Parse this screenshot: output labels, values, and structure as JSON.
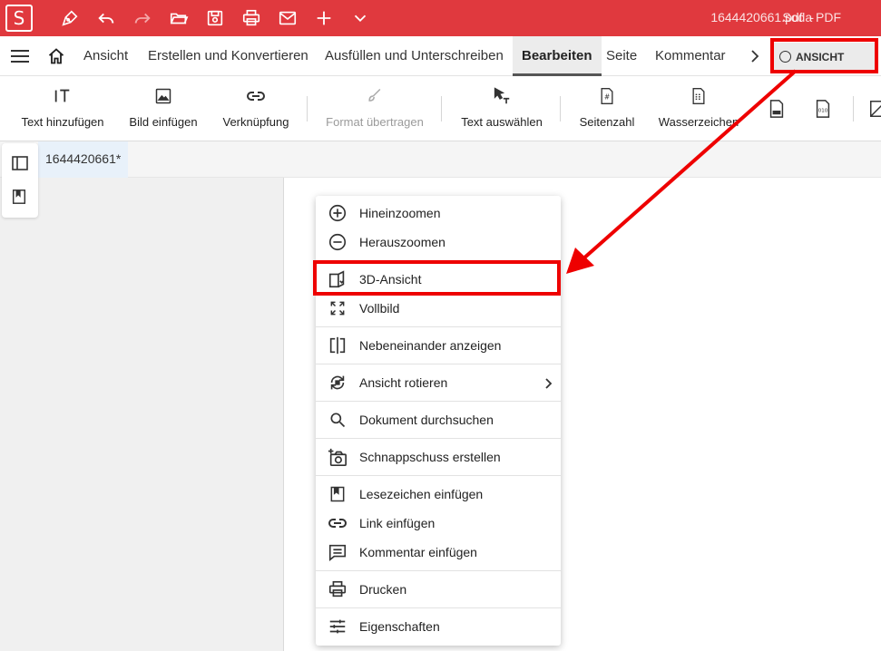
{
  "titlebar": {
    "logo_letter": "S",
    "file_name": "1644420661.pdf",
    "separator": "-",
    "app_name": "Soda PDF",
    "background_color": "#e0393e"
  },
  "quick_access": [
    "pen-icon",
    "undo-icon",
    "redo-icon",
    "open-folder-icon",
    "save-icon",
    "print-icon",
    "mail-icon",
    "plus-icon",
    "chevron-down-icon"
  ],
  "tabs": {
    "items": [
      {
        "label": "Ansicht"
      },
      {
        "label": "Erstellen und Konvertieren"
      },
      {
        "label": "Ausfüllen und Unterschreiben"
      },
      {
        "label": "Bearbeiten"
      },
      {
        "label": "Seite"
      },
      {
        "label": "Kommentar"
      }
    ],
    "active": "Bearbeiten",
    "view_button_label": "ANSICHT"
  },
  "toolbar": {
    "items": [
      {
        "label": "Text hinzufügen",
        "icon": "text-add-icon",
        "enabled": true
      },
      {
        "label": "Bild einfügen",
        "icon": "image-icon",
        "enabled": true
      },
      {
        "label": "Verknüpfung",
        "icon": "link-icon",
        "enabled": true
      },
      {
        "label": "Format übertragen",
        "icon": "format-brush-icon",
        "enabled": false
      },
      {
        "label": "Text auswählen",
        "icon": "text-select-icon",
        "enabled": true
      },
      {
        "label": "Seitenzahl",
        "icon": "page-number-icon",
        "enabled": true
      },
      {
        "label": "Wasserzeichen",
        "icon": "watermark-icon",
        "enabled": true
      }
    ]
  },
  "document_tab": {
    "label": "1644420661*"
  },
  "context_menu": {
    "items": [
      {
        "label": "Hineinzoomen",
        "icon": "zoom-in-icon"
      },
      {
        "label": "Herauszoomen",
        "icon": "zoom-out-icon"
      },
      {
        "label": "3D-Ansicht",
        "icon": "3d-view-icon",
        "highlighted": true
      },
      {
        "label": "Vollbild",
        "icon": "fullscreen-icon"
      },
      {
        "label": "Nebeneinander anzeigen",
        "icon": "side-by-side-icon"
      },
      {
        "label": "Ansicht rotieren",
        "icon": "rotate-icon",
        "has_submenu": true
      },
      {
        "label": "Dokument durchsuchen",
        "icon": "search-icon"
      },
      {
        "label": "Schnappschuss erstellen",
        "icon": "snapshot-icon"
      },
      {
        "label": "Lesezeichen einfügen",
        "icon": "bookmark-icon"
      },
      {
        "label": "Link einfügen",
        "icon": "link-icon"
      },
      {
        "label": "Kommentar einfügen",
        "icon": "comment-icon"
      },
      {
        "label": "Drucken",
        "icon": "print-icon"
      },
      {
        "label": "Eigenschaften",
        "icon": "properties-icon"
      }
    ]
  },
  "annotation_color": "#e00000"
}
